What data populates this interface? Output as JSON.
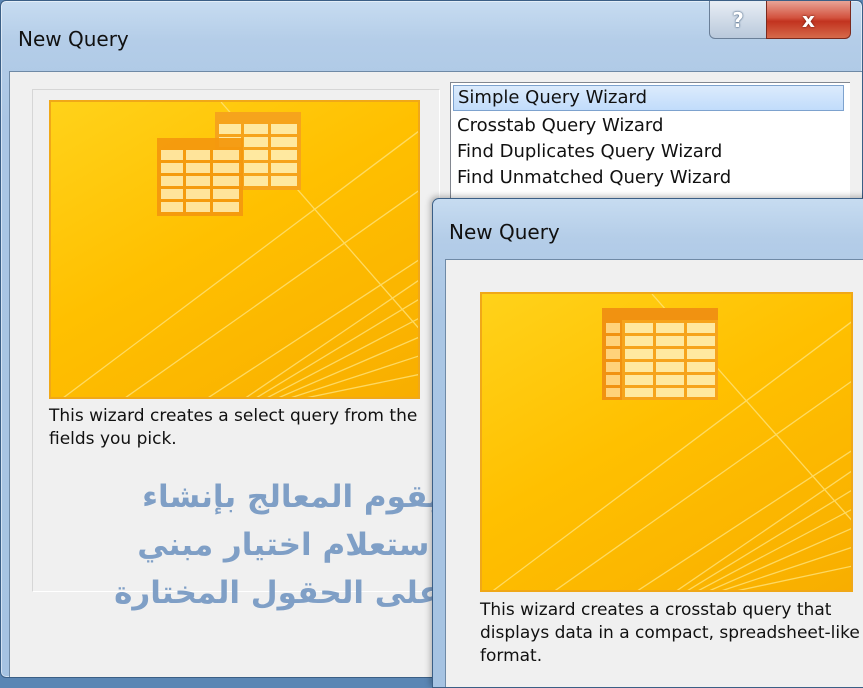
{
  "window_back": {
    "title": "New Query",
    "help_label": "?",
    "close_label": "x",
    "description": "This wizard creates a select query from the fields you pick.",
    "arabic_lines": [
      "يقوم المعالج بإنشاء",
      "استعلام اختيار مبني",
      "على الحقول المختارة"
    ],
    "list_items": [
      "Simple Query Wizard",
      "Crosstab Query Wizard",
      "Find Duplicates Query Wizard",
      "Find Unmatched Query Wizard"
    ],
    "selected_index": 0
  },
  "window_front": {
    "title": "New Query",
    "description": "This wizard creates a crosstab query that displays data in a compact, spreadsheet-like format."
  },
  "colors": {
    "art_orange": "#ffc000",
    "art_border": "#f0a818",
    "arabic_text": "#7f9fc6",
    "close_red": "#c2331f"
  }
}
